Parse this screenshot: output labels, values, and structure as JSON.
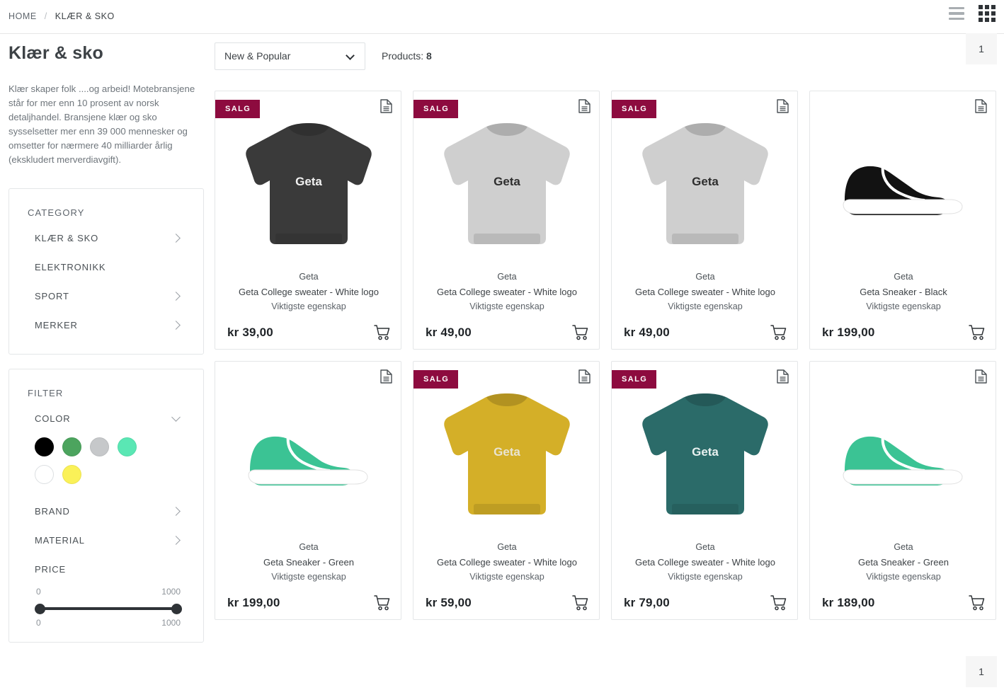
{
  "breadcrumb": {
    "home": "HOME",
    "separator": "/",
    "current": "KLÆR & SKO"
  },
  "header": {
    "list_view_icon": "list-view-icon",
    "grid_view_icon": "grid-view-icon"
  },
  "sidebar": {
    "title": "Klær & sko",
    "intro": "Klær skaper folk ....og arbeid! Motebransjene står for mer enn 10 prosent av norsk detaljhandel. Bransjene klær og sko sysselsetter mer enn 39 000 mennesker og omsetter for nærmere 40 milliarder årlig (ekskludert merverdiavgift).",
    "category": {
      "title": "CATEGORY",
      "items": [
        {
          "label": "KLÆR & SKO",
          "chevron": true
        },
        {
          "label": "ELEKTRONIKK",
          "chevron": false
        },
        {
          "label": "SPORT",
          "chevron": true
        },
        {
          "label": "MERKER",
          "chevron": true
        }
      ]
    },
    "filter": {
      "title": "FILTER",
      "color": {
        "label": "COLOR",
        "expanded": true,
        "swatches": [
          {
            "name": "black",
            "hex": "#000000"
          },
          {
            "name": "green",
            "hex": "#4CA45E"
          },
          {
            "name": "grey",
            "hex": "#C6C8CA"
          },
          {
            "name": "mint",
            "hex": "#5AE7B4"
          },
          {
            "name": "white",
            "hex": "#FFFFFF"
          },
          {
            "name": "yellow",
            "hex": "#FAF158"
          }
        ]
      },
      "brand": {
        "label": "BRAND"
      },
      "material": {
        "label": "MATERIAL"
      },
      "price": {
        "label": "PRICE",
        "min_top": "0",
        "max_top": "1000",
        "min_bottom": "0",
        "max_bottom": "1000"
      }
    }
  },
  "toolbar": {
    "sort_value": "New & Popular",
    "products_label": "Products:",
    "products_count": "8"
  },
  "pagination": {
    "top_page": "1",
    "bottom_page": "1"
  },
  "labels": {
    "badge_sale": "SALG",
    "doc_icon": "document-icon",
    "cart_icon": "cart-icon"
  },
  "colors": {
    "badge": "#8d0b3f",
    "price_text": "#1f2327",
    "card_border": "#e4e6e8"
  },
  "products": [
    {
      "badge": "SALG",
      "brand": "Geta",
      "name": "Geta College sweater - White logo",
      "sub": "Viktigste egenskap",
      "price": "kr 39,00",
      "art": "sweater",
      "color": "#3a3a3a",
      "logo_color": "#f2f2f2"
    },
    {
      "badge": "SALG",
      "brand": "Geta",
      "name": "Geta College sweater - White logo",
      "sub": "Viktigste egenskap",
      "price": "kr 49,00",
      "art": "sweater",
      "color": "#cfcfcf",
      "logo_color": "#2e2e2e"
    },
    {
      "badge": "SALG",
      "brand": "Geta",
      "name": "Geta College sweater - White logo",
      "sub": "Viktigste egenskap",
      "price": "kr 49,00",
      "art": "sweater",
      "color": "#cfcfcf",
      "logo_color": "#2e2e2e"
    },
    {
      "badge": "",
      "brand": "Geta",
      "name": "Geta Sneaker - Black",
      "sub": "Viktigste egenskap",
      "price": "kr 199,00",
      "art": "sneaker",
      "color": "#121212",
      "logo_color": "#ffffff"
    },
    {
      "badge": "",
      "brand": "Geta",
      "name": "Geta Sneaker - Green",
      "sub": "Viktigste egenskap",
      "price": "kr 199,00",
      "art": "sneaker",
      "color": "#3BC394",
      "logo_color": "#ffffff"
    },
    {
      "badge": "SALG",
      "brand": "Geta",
      "name": "Geta College sweater - White logo",
      "sub": "Viktigste egenskap",
      "price": "kr 59,00",
      "art": "sweater",
      "color": "#d4af28",
      "logo_color": "#e9e4d2"
    },
    {
      "badge": "SALG",
      "brand": "Geta",
      "name": "Geta College sweater - White logo",
      "sub": "Viktigste egenskap",
      "price": "kr 79,00",
      "art": "sweater",
      "color": "#2b6b69",
      "logo_color": "#e8f1f0"
    },
    {
      "badge": "",
      "brand": "Geta",
      "name": "Geta Sneaker - Green",
      "sub": "Viktigste egenskap",
      "price": "kr 189,00",
      "art": "sneaker",
      "color": "#3BC394",
      "logo_color": "#ffffff"
    }
  ]
}
